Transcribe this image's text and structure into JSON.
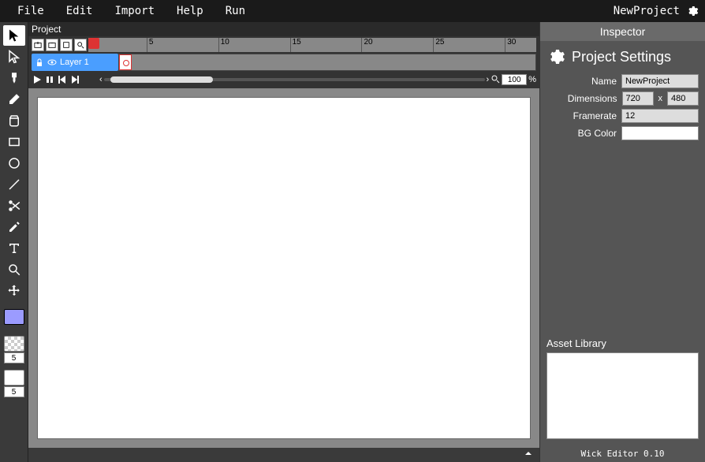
{
  "menu": {
    "items": [
      "File",
      "Edit",
      "Import",
      "Help",
      "Run"
    ],
    "project_name": "NewProject"
  },
  "timeline": {
    "title": "Project",
    "ruler_ticks": [
      "5",
      "10",
      "15",
      "20",
      "25",
      "30"
    ],
    "layer_name": "Layer 1",
    "zoom_value": "100",
    "zoom_suffix": "%"
  },
  "inspector": {
    "header": "Inspector",
    "title": "Project Settings",
    "name_label": "Name",
    "name_value": "NewProject",
    "dim_label": "Dimensions",
    "dim_w": "720",
    "dim_x": "x",
    "dim_h": "480",
    "fr_label": "Framerate",
    "fr_value": "12",
    "bg_label": "BG Color",
    "asset_label": "Asset Library",
    "footer": "Wick Editor 0.10"
  },
  "toolbox": {
    "stroke_width_1": "5",
    "stroke_width_2": "5"
  }
}
